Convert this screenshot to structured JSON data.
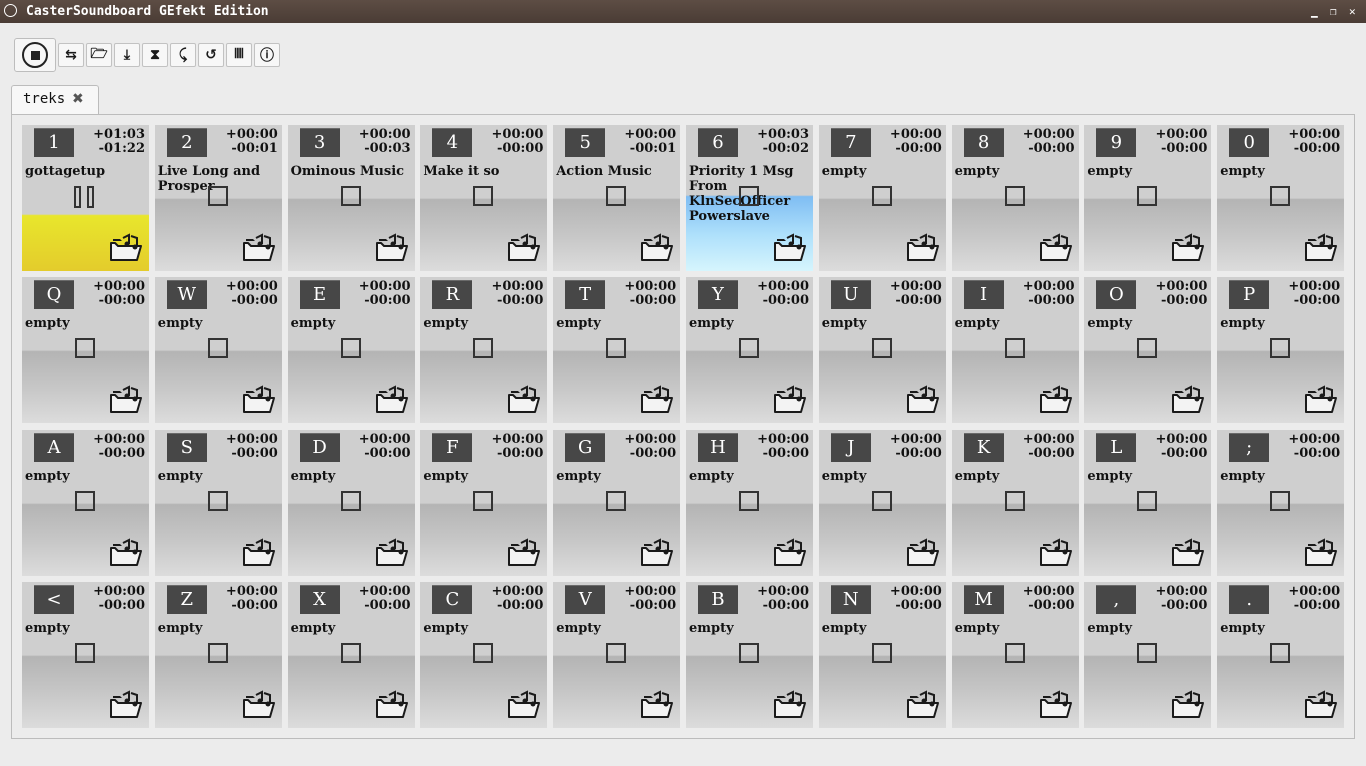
{
  "window": {
    "title": "CasterSoundboard GEfekt Edition"
  },
  "toolbar": {
    "buttons": [
      {
        "name": "add-tab-button",
        "glyph": "⇆"
      },
      {
        "name": "open-board-button",
        "glyph": "🗁"
      },
      {
        "name": "save-board-button",
        "glyph": "⤓"
      },
      {
        "name": "timer-button",
        "glyph": "⧗"
      },
      {
        "name": "remove-tab-button",
        "glyph": "⤹"
      },
      {
        "name": "undo-button",
        "glyph": "↺"
      },
      {
        "name": "keyboard-button",
        "glyph": "𝍬"
      },
      {
        "name": "info-button",
        "glyph": "ⓘ"
      }
    ]
  },
  "tabs": [
    {
      "label": "treks"
    }
  ],
  "tiles": [
    [
      {
        "key": "1",
        "elapsed": "+01:03",
        "remaining": "-01:22",
        "name": "gottagetup",
        "state": "playing"
      },
      {
        "key": "2",
        "elapsed": "+00:00",
        "remaining": "-00:01",
        "name": "Live Long and Prosper",
        "state": "stopped"
      },
      {
        "key": "3",
        "elapsed": "+00:00",
        "remaining": "-00:03",
        "name": "Ominous Music",
        "state": "stopped"
      },
      {
        "key": "4",
        "elapsed": "+00:00",
        "remaining": "-00:00",
        "name": "Make it so",
        "state": "stopped"
      },
      {
        "key": "5",
        "elapsed": "+00:00",
        "remaining": "-00:01",
        "name": "Action Music",
        "state": "stopped"
      },
      {
        "key": "6",
        "elapsed": "+00:03",
        "remaining": "-00:02",
        "name": "Priority 1 Msg From KlnSecOfficer Powerslave",
        "state": "queued"
      },
      {
        "key": "7",
        "elapsed": "+00:00",
        "remaining": "-00:00",
        "name": "empty",
        "state": "stopped"
      },
      {
        "key": "8",
        "elapsed": "+00:00",
        "remaining": "-00:00",
        "name": "empty",
        "state": "stopped"
      },
      {
        "key": "9",
        "elapsed": "+00:00",
        "remaining": "-00:00",
        "name": "empty",
        "state": "stopped"
      },
      {
        "key": "0",
        "elapsed": "+00:00",
        "remaining": "-00:00",
        "name": "empty",
        "state": "stopped"
      }
    ],
    [
      {
        "key": "Q",
        "elapsed": "+00:00",
        "remaining": "-00:00",
        "name": "empty",
        "state": "stopped"
      },
      {
        "key": "W",
        "elapsed": "+00:00",
        "remaining": "-00:00",
        "name": "empty",
        "state": "stopped"
      },
      {
        "key": "E",
        "elapsed": "+00:00",
        "remaining": "-00:00",
        "name": "empty",
        "state": "stopped"
      },
      {
        "key": "R",
        "elapsed": "+00:00",
        "remaining": "-00:00",
        "name": "empty",
        "state": "stopped"
      },
      {
        "key": "T",
        "elapsed": "+00:00",
        "remaining": "-00:00",
        "name": "empty",
        "state": "stopped"
      },
      {
        "key": "Y",
        "elapsed": "+00:00",
        "remaining": "-00:00",
        "name": "empty",
        "state": "stopped"
      },
      {
        "key": "U",
        "elapsed": "+00:00",
        "remaining": "-00:00",
        "name": "empty",
        "state": "stopped"
      },
      {
        "key": "I",
        "elapsed": "+00:00",
        "remaining": "-00:00",
        "name": "empty",
        "state": "stopped"
      },
      {
        "key": "O",
        "elapsed": "+00:00",
        "remaining": "-00:00",
        "name": "empty",
        "state": "stopped"
      },
      {
        "key": "P",
        "elapsed": "+00:00",
        "remaining": "-00:00",
        "name": "empty",
        "state": "stopped"
      }
    ],
    [
      {
        "key": "A",
        "elapsed": "+00:00",
        "remaining": "-00:00",
        "name": "empty",
        "state": "stopped"
      },
      {
        "key": "S",
        "elapsed": "+00:00",
        "remaining": "-00:00",
        "name": "empty",
        "state": "stopped"
      },
      {
        "key": "D",
        "elapsed": "+00:00",
        "remaining": "-00:00",
        "name": "empty",
        "state": "stopped"
      },
      {
        "key": "F",
        "elapsed": "+00:00",
        "remaining": "-00:00",
        "name": "empty",
        "state": "stopped"
      },
      {
        "key": "G",
        "elapsed": "+00:00",
        "remaining": "-00:00",
        "name": "empty",
        "state": "stopped"
      },
      {
        "key": "H",
        "elapsed": "+00:00",
        "remaining": "-00:00",
        "name": "empty",
        "state": "stopped"
      },
      {
        "key": "J",
        "elapsed": "+00:00",
        "remaining": "-00:00",
        "name": "empty",
        "state": "stopped"
      },
      {
        "key": "K",
        "elapsed": "+00:00",
        "remaining": "-00:00",
        "name": "empty",
        "state": "stopped"
      },
      {
        "key": "L",
        "elapsed": "+00:00",
        "remaining": "-00:00",
        "name": "empty",
        "state": "stopped"
      },
      {
        "key": ";",
        "elapsed": "+00:00",
        "remaining": "-00:00",
        "name": "empty",
        "state": "stopped"
      }
    ],
    [
      {
        "key": "<",
        "elapsed": "+00:00",
        "remaining": "-00:00",
        "name": "empty",
        "state": "stopped"
      },
      {
        "key": "Z",
        "elapsed": "+00:00",
        "remaining": "-00:00",
        "name": "empty",
        "state": "stopped"
      },
      {
        "key": "X",
        "elapsed": "+00:00",
        "remaining": "-00:00",
        "name": "empty",
        "state": "stopped"
      },
      {
        "key": "C",
        "elapsed": "+00:00",
        "remaining": "-00:00",
        "name": "empty",
        "state": "stopped"
      },
      {
        "key": "V",
        "elapsed": "+00:00",
        "remaining": "-00:00",
        "name": "empty",
        "state": "stopped"
      },
      {
        "key": "B",
        "elapsed": "+00:00",
        "remaining": "-00:00",
        "name": "empty",
        "state": "stopped"
      },
      {
        "key": "N",
        "elapsed": "+00:00",
        "remaining": "-00:00",
        "name": "empty",
        "state": "stopped"
      },
      {
        "key": "M",
        "elapsed": "+00:00",
        "remaining": "-00:00",
        "name": "empty",
        "state": "stopped"
      },
      {
        "key": ",",
        "elapsed": "+00:00",
        "remaining": "-00:00",
        "name": "empty",
        "state": "stopped"
      },
      {
        "key": ".",
        "elapsed": "+00:00",
        "remaining": "-00:00",
        "name": "empty",
        "state": "stopped"
      }
    ]
  ],
  "colors": {
    "playing": "#e8e62c",
    "queued": "#7fbdf3",
    "key_badge": "#474747",
    "titlebar": "#4f4039"
  }
}
